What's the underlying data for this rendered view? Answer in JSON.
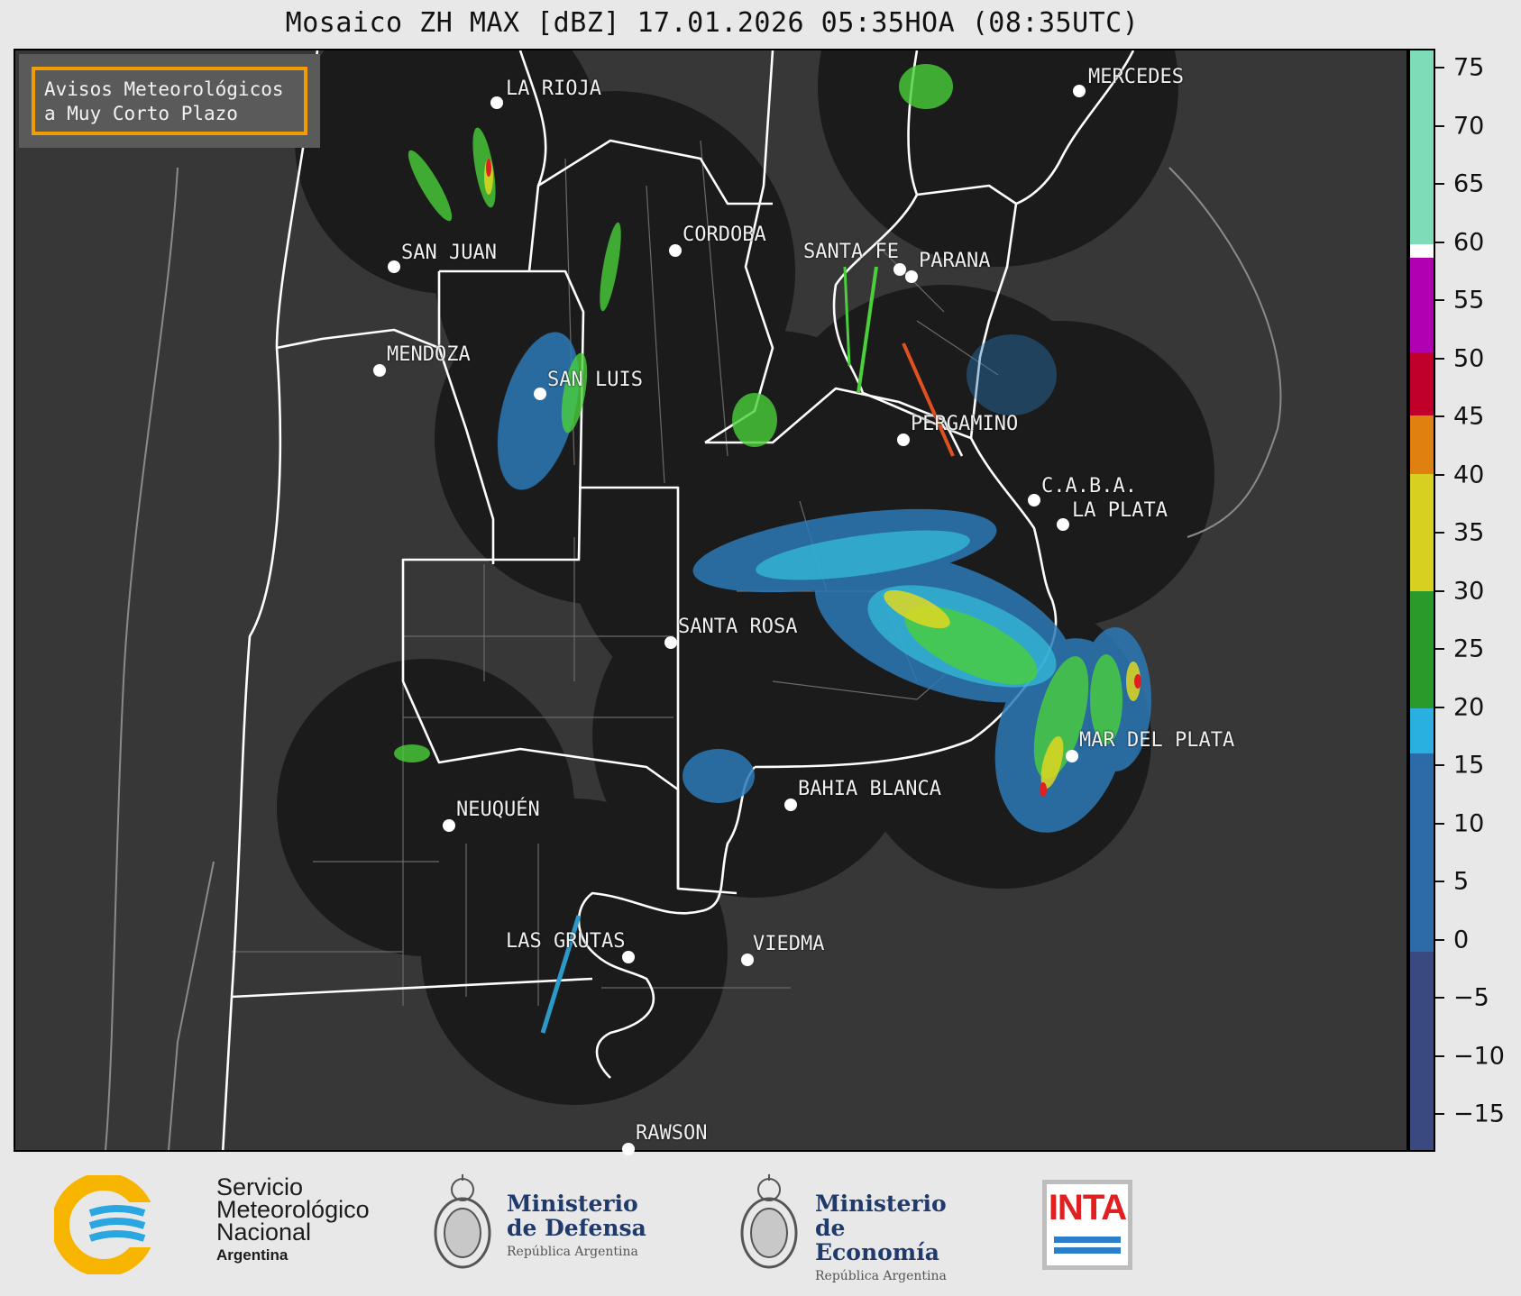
{
  "title": "Mosaico ZH MAX [dBZ] 17.01.2026 05:35HOA (08:35UTC)",
  "notice": {
    "line1": "Avisos Meteorológicos",
    "line2": "a Muy Corto Plazo"
  },
  "colorbar": {
    "unit": "dBZ",
    "ticks": [
      "75",
      "70",
      "65",
      "60",
      "55",
      "50",
      "45",
      "40",
      "35",
      "30",
      "25",
      "20",
      "15",
      "10",
      "5",
      "0",
      "−5",
      "−10",
      "−15"
    ],
    "colors": {
      "60to75": "#7fdcb8",
      "55to60": "#b000b0",
      "45to55": "#c0002a",
      "40to45": "#e08010",
      "30to40": "#d8d020",
      "20to30": "#2a9a2a",
      "15to20": "#2ab0e0",
      "0to15": "#2c6aa8",
      "neg": "#3a4a80"
    }
  },
  "cities": [
    {
      "name": "LA RIOJA"
    },
    {
      "name": "MERCEDES"
    },
    {
      "name": "CORDOBA"
    },
    {
      "name": "SAN JUAN"
    },
    {
      "name": "SANTA FE"
    },
    {
      "name": "PARANA"
    },
    {
      "name": "MENDOZA"
    },
    {
      "name": "SAN LUIS"
    },
    {
      "name": "PERGAMINO"
    },
    {
      "name": "C.A.B.A."
    },
    {
      "name": "LA PLATA"
    },
    {
      "name": "SANTA ROSA"
    },
    {
      "name": "MAR DEL PLATA"
    },
    {
      "name": "BAHIA BLANCA"
    },
    {
      "name": "NEUQUÉN"
    },
    {
      "name": "LAS GRUTAS"
    },
    {
      "name": "VIEDMA"
    },
    {
      "name": "RAWSON"
    }
  ],
  "logos": {
    "smn": {
      "line1": "Servicio",
      "line2": "Meteorológico",
      "line3": "Nacional",
      "line4": "Argentina"
    },
    "defensa": {
      "line1": "Ministerio",
      "line2": "de Defensa",
      "line3": "República Argentina"
    },
    "economia": {
      "line1": "Ministerio",
      "line2": "de Economía",
      "line3": "República Argentina"
    },
    "inta": {
      "text": "INTA"
    }
  }
}
